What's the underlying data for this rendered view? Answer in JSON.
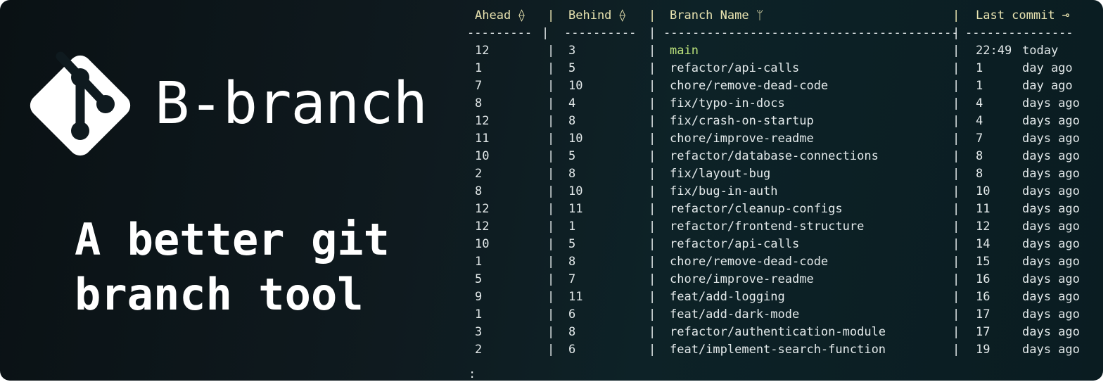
{
  "app": {
    "name": "B-branch",
    "tagline_line1": "A better git",
    "tagline_line2": "branch tool",
    "logo_icon": "git-branch-diamond-icon",
    "accent_color": "#b9e07a",
    "header_color": "#e8e3b0"
  },
  "terminal": {
    "headers": {
      "ahead": "Ahead ⟠",
      "behind": "Behind ⟠",
      "branch": "Branch Name ᛘ",
      "commit": "Last commit ⊸"
    },
    "pipe": "|",
    "dashes": {
      "ahead": "---------",
      "behind": "----------",
      "branch": "-----------------------------------------",
      "commit": "---------------"
    },
    "rows": [
      {
        "ahead": "12",
        "behind": "3",
        "branch": "main",
        "commit": "22:49",
        "unit": "today"
      },
      {
        "ahead": "1",
        "behind": "5",
        "branch": "refactor/api-calls",
        "commit": "1",
        "unit": "day ago"
      },
      {
        "ahead": "7",
        "behind": "10",
        "branch": "chore/remove-dead-code",
        "commit": "1",
        "unit": "day ago"
      },
      {
        "ahead": "8",
        "behind": "4",
        "branch": "fix/typo-in-docs",
        "commit": "4",
        "unit": "days ago"
      },
      {
        "ahead": "12",
        "behind": "8",
        "branch": "fix/crash-on-startup",
        "commit": "4",
        "unit": "days ago"
      },
      {
        "ahead": "11",
        "behind": "10",
        "branch": "chore/improve-readme",
        "commit": "7",
        "unit": "days ago"
      },
      {
        "ahead": "10",
        "behind": "5",
        "branch": "refactor/database-connections",
        "commit": "8",
        "unit": "days ago"
      },
      {
        "ahead": "2",
        "behind": "8",
        "branch": "fix/layout-bug",
        "commit": "8",
        "unit": "days ago"
      },
      {
        "ahead": "8",
        "behind": "10",
        "branch": "fix/bug-in-auth",
        "commit": "10",
        "unit": "days ago"
      },
      {
        "ahead": "12",
        "behind": "11",
        "branch": "refactor/cleanup-configs",
        "commit": "11",
        "unit": "days ago"
      },
      {
        "ahead": "12",
        "behind": "1",
        "branch": "refactor/frontend-structure",
        "commit": "12",
        "unit": "days ago"
      },
      {
        "ahead": "10",
        "behind": "5",
        "branch": "refactor/api-calls",
        "commit": "14",
        "unit": "days ago"
      },
      {
        "ahead": "1",
        "behind": "8",
        "branch": "chore/remove-dead-code",
        "commit": "15",
        "unit": "days ago"
      },
      {
        "ahead": "5",
        "behind": "7",
        "branch": "chore/improve-readme",
        "commit": "16",
        "unit": "days ago"
      },
      {
        "ahead": "9",
        "behind": "11",
        "branch": "feat/add-logging",
        "commit": "16",
        "unit": "days ago"
      },
      {
        "ahead": "1",
        "behind": "6",
        "branch": "feat/add-dark-mode",
        "commit": "17",
        "unit": "days ago"
      },
      {
        "ahead": "3",
        "behind": "8",
        "branch": "refactor/authentication-module",
        "commit": "17",
        "unit": "days ago"
      },
      {
        "ahead": "2",
        "behind": "6",
        "branch": "feat/implement-search-function",
        "commit": "19",
        "unit": "days ago"
      }
    ],
    "prompt": ":"
  }
}
